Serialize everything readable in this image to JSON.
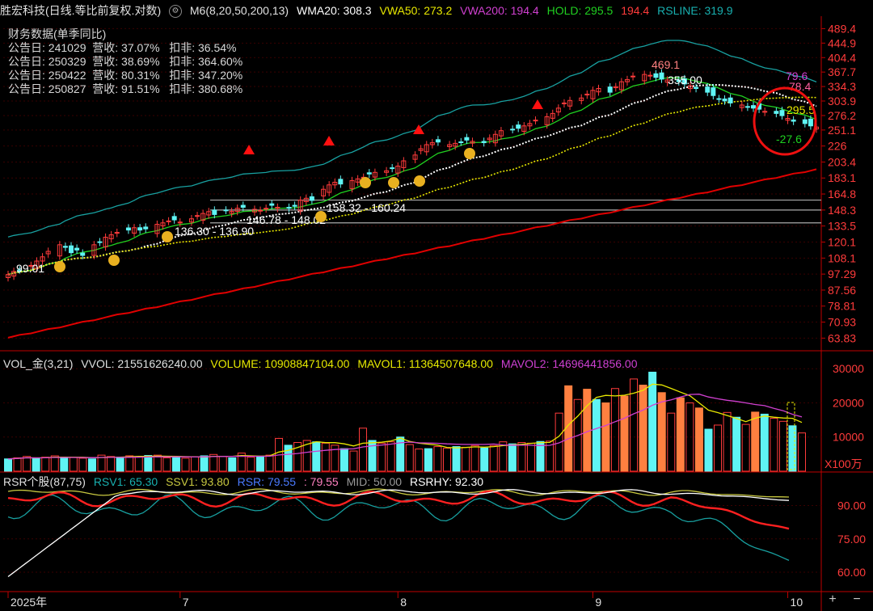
{
  "price_header": {
    "stock_title": "胜宏科技(日线.等比前复权.对数)",
    "m6": "M6(8,20,50,200,13)",
    "wma20": "WMA20: 308.3",
    "vwa50": "VWA50: 273.2",
    "vwa200": "VWA200: 194.4",
    "hold": "HOLD: 295.5",
    "hold_extra": "194.4",
    "rsline": "RSLINE: 319.9",
    "settings_icon": "gear-icon"
  },
  "financials": {
    "title": "财务数据(单季同比)",
    "rows": [
      "公告日: 241029  营收: 37.07%   扣非: 36.54%",
      "公告日: 250329  营收: 38.69%   扣非: 364.60%",
      "公告日: 250422  营收: 80.31%   扣非: 347.20%",
      "公告日: 250827  营收: 91.51%   扣非: 380.68%"
    ]
  },
  "volume_header": {
    "title": "VOL_金(3,21)",
    "vvol": "VVOL: 21551626240.00",
    "volume": "VOLUME: 10908847104.00",
    "mavol1": "MAVOL1: 11364507648.00",
    "mavol2": "MAVOL2: 14696441856.00",
    "unit": "X100万"
  },
  "rsr_header": {
    "title": "RSR个股(87,75)",
    "rsv1": "RSV1: 65.30",
    "ssv1": "SSV1: 93.80",
    "rsr": "RSR: 79.55",
    "rsr2": ": 79.55",
    "mid": "MID: 50.00",
    "rsrhy": "RSRHY: 92.30"
  },
  "colors": {
    "bg": "#000000",
    "grid": "#3a0000",
    "axis": "#c00000",
    "up": "#ff3b3b",
    "down": "#5ff4f4",
    "orange": "#ff8040",
    "yellow": "#e8e800",
    "magenta": "#d040d0",
    "green": "#20d020",
    "cyan_band": "#18a0a0",
    "red_ma": "#e00000",
    "white": "#ffffff",
    "rsr_pink": "#ff80c0"
  },
  "chart_data": [
    {
      "type": "candlestick",
      "title": "胜宏科技(日线.等比前复权.对数)",
      "y_scale": "log",
      "y_ticks": [
        489.4,
        444.9,
        404.4,
        367.7,
        334.3,
        303.9,
        276.2,
        251.1,
        226.0,
        203.4,
        183.1,
        164.8,
        148.3,
        133.5,
        120.1,
        108.1,
        97.29,
        87.56,
        78.81,
        70.93,
        63.83
      ],
      "ylim": [
        60,
        520
      ],
      "x_labels": [
        "2025年",
        "7",
        "8",
        "9",
        "10"
      ],
      "x_label_index": [
        0,
        30,
        68,
        102,
        136
      ],
      "n_bars": 142,
      "closes": [
        97,
        99.01,
        100,
        103,
        106,
        109,
        113,
        118,
        116,
        112,
        114,
        110,
        118,
        120,
        124,
        126,
        128,
        130,
        132,
        130,
        131,
        135,
        136.3,
        138,
        139,
        137,
        140,
        143,
        145,
        146.78,
        144,
        148,
        147,
        150,
        151,
        149,
        148.02,
        150,
        153,
        151,
        150,
        152,
        158.32,
        160.24,
        158,
        170,
        175,
        178,
        176,
        180,
        182,
        184,
        188,
        190,
        192,
        195,
        198,
        205,
        213,
        222,
        228,
        231,
        232,
        228,
        230,
        232,
        235,
        233,
        231,
        238,
        244,
        250,
        252,
        254,
        258,
        262,
        268,
        274,
        280,
        290,
        300,
        305,
        310,
        318,
        326,
        330,
        322,
        334,
        345,
        350,
        358,
        362,
        360,
        355,
        351,
        349,
        345,
        340,
        336,
        330,
        322,
        315,
        308,
        304,
        300,
        296,
        292,
        290,
        288,
        284,
        280,
        276,
        271,
        266,
        262,
        258,
        256
      ],
      "candle_last_annotation": {
        "high": "469.1",
        "level": "355.00",
        "rsline_label": "79.6",
        "rsline_label2": "78.4",
        "hold_label": "295.5",
        "chg_label": "-27.6"
      },
      "price_labels": [
        "99.01",
        "136.30 - 136.90",
        "146.78 - 148.02",
        "158.32 - 160.24"
      ],
      "hlines": [
        158.32,
        148.3,
        136.3
      ]
    },
    {
      "type": "bar",
      "title": "VOL_金(3,21)",
      "y_ticks": [
        30000,
        20000,
        10000
      ],
      "ylim": [
        0,
        31000
      ],
      "unit": "X100万",
      "volume_in_100m": [
        3600,
        3900,
        4300,
        3800,
        4100,
        4500,
        3900,
        4000,
        3800,
        3600,
        4700,
        4300,
        4100,
        4500,
        4200,
        4600,
        4700,
        3900,
        4300,
        3800,
        4200,
        4500,
        4900,
        4300,
        3900,
        5300,
        4100,
        4400,
        4700,
        9600,
        7600,
        8400,
        9000,
        8600,
        8200,
        7600,
        6600,
        5900,
        12600,
        9000,
        8200,
        8600,
        10000,
        7800,
        6500,
        6600,
        7200,
        6700,
        7200,
        7000,
        7500,
        6800,
        7500,
        8600,
        8000,
        8400,
        8200,
        8700,
        8800,
        17000,
        25000,
        21000,
        24000,
        21000,
        20000,
        24200,
        22000,
        27000,
        25200,
        29000,
        23000,
        17000,
        21500,
        20000,
        18500,
        12300,
        13500,
        17200,
        15800,
        13700,
        17300,
        16700,
        15500,
        14600,
        13300,
        11200
      ]
    },
    {
      "type": "line",
      "title": "RSR个股(87,75)",
      "y_ticks": [
        90.0,
        75.0,
        60.0
      ],
      "ylim": [
        52,
        100
      ],
      "series": [
        {
          "name": "RSV1",
          "color": "#18a0a0",
          "last": 65.3
        },
        {
          "name": "SSV1",
          "color": "#c8c840",
          "last": 93.8
        },
        {
          "name": "RSR",
          "color": "#ff2020",
          "last": 79.55
        },
        {
          "name": "MID",
          "color": "#888888",
          "last": 50.0
        },
        {
          "name": "RSRHY",
          "color": "#ffffff",
          "last": 92.3
        }
      ]
    }
  ]
}
